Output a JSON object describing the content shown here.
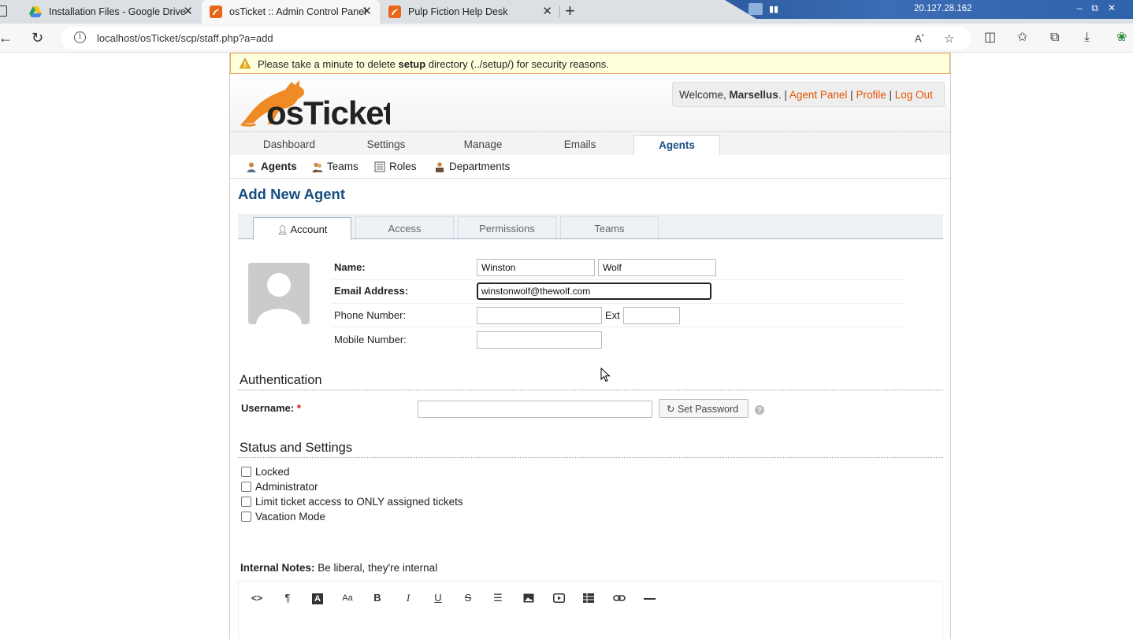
{
  "browser": {
    "tabs": [
      {
        "title": "Installation Files - Google Drive"
      },
      {
        "title": "osTicket :: Admin Control Panel"
      },
      {
        "title": "Pulp Fiction Help Desk"
      }
    ],
    "url": "localhost/osTicket/scp/staff.php?a=add",
    "remote_ip": "20.127.28.162"
  },
  "warning": {
    "pre": "Please take a minute to delete ",
    "bold": "setup",
    "post": " directory (../setup/) for security reasons."
  },
  "header": {
    "logo_text": "osTicket",
    "welcome_prefix": "Welcome, ",
    "user": "Marsellus",
    "welcome_suffix": ". |",
    "links": [
      "Agent Panel",
      "Profile",
      "Log Out"
    ],
    "sep": "|"
  },
  "main_nav": [
    "Dashboard",
    "Settings",
    "Manage",
    "Emails",
    "Agents"
  ],
  "sub_nav": [
    "Agents",
    "Teams",
    "Roles",
    "Departments"
  ],
  "page_title": "Add New Agent",
  "form_tabs": [
    "Account",
    "Access",
    "Permissions",
    "Teams"
  ],
  "account": {
    "name_label": "Name:",
    "first_name": "Winston",
    "last_name": "Wolf",
    "email_label": "Email Address:",
    "email": "winstonwolf@thewolf.com",
    "phone_label": "Phone Number:",
    "phone": "",
    "ext_label": "Ext",
    "ext": "",
    "mobile_label": "Mobile Number:",
    "mobile": ""
  },
  "auth": {
    "title": "Authentication",
    "username_label": "Username:",
    "required_mark": "*",
    "username": "",
    "set_password": "Set Password",
    "help": "?"
  },
  "status": {
    "title": "Status and Settings",
    "options": [
      {
        "label": "Locked",
        "checked": false
      },
      {
        "label": "Administrator",
        "checked": false
      },
      {
        "label": "Limit ticket access to ONLY assigned tickets",
        "checked": false
      },
      {
        "label": "Vacation Mode",
        "checked": false
      }
    ]
  },
  "notes": {
    "label": "Internal Notes:",
    "hint": "Be liberal, they're internal"
  },
  "editor_toolbar": [
    "<>",
    "¶",
    "A",
    "Aa",
    "B",
    "I",
    "U",
    "S",
    "list",
    "image",
    "video",
    "table",
    "link",
    "hr"
  ],
  "colors": {
    "accent": "#184e81",
    "link": "#e55300",
    "warning_bg": "#ffffdd",
    "warning_border": "#f0a35d"
  }
}
